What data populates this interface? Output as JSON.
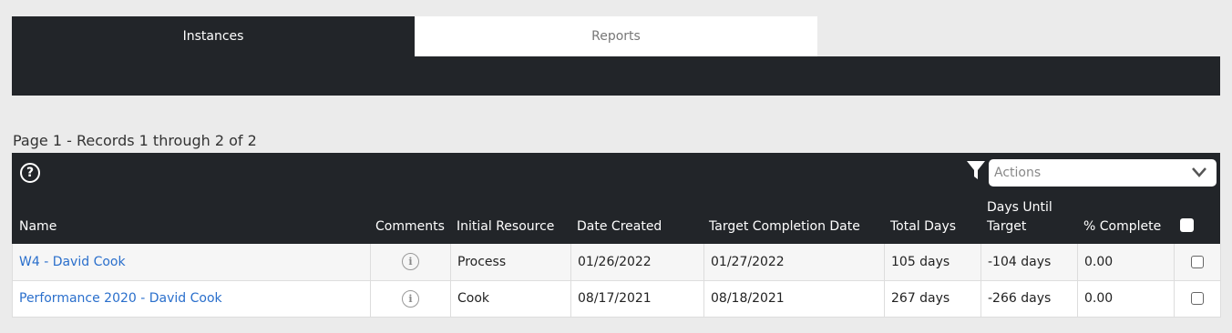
{
  "tabs": [
    {
      "label": "Instances",
      "active": true
    },
    {
      "label": "Reports",
      "active": false
    }
  ],
  "records_text": "Page 1 - Records 1 through 2 of 2",
  "toolbar": {
    "help_icon": "question-circle-icon",
    "filter_icon": "funnel-icon",
    "actions_placeholder": "Actions"
  },
  "columns": {
    "name": "Name",
    "comments": "Comments",
    "initial_resource": "Initial Resource",
    "date_created": "Date Created",
    "target_completion": "Target Completion Date",
    "total_days": "Total Days",
    "days_until_line1": "Days Until",
    "days_until_line2": "Target",
    "percent_complete": "% Complete"
  },
  "rows": [
    {
      "name": "W4 - David Cook",
      "initial_resource": "Process",
      "date_created": "01/26/2022",
      "target_completion": "01/27/2022",
      "total_days": "105 days",
      "days_until": "-104 days",
      "percent_complete": "0.00"
    },
    {
      "name": "Performance 2020 - David Cook",
      "initial_resource": "Cook",
      "date_created": "08/17/2021",
      "target_completion": "08/18/2021",
      "total_days": "267 days",
      "days_until": "-266 days",
      "percent_complete": "0.00"
    }
  ],
  "colors": {
    "header_bg": "#222529",
    "link": "#2a6fcc",
    "page_bg": "#ebebeb"
  }
}
